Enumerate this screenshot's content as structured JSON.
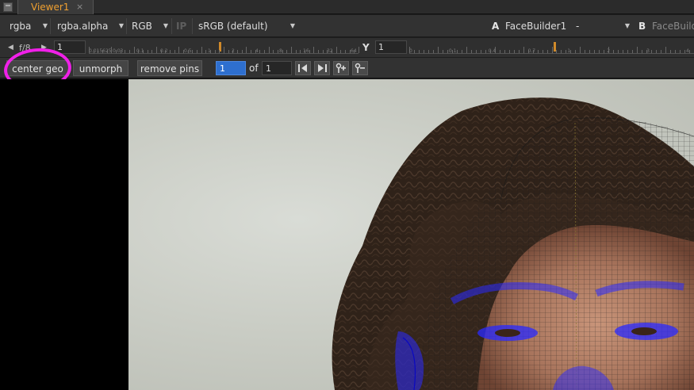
{
  "tab": {
    "title": "Viewer1",
    "close": "×"
  },
  "toolbar": {
    "channels": "rgba",
    "alpha_channel": "rgba.alpha",
    "display_channel": "RGB",
    "ip": "IP",
    "colorspace": "sRGB (default)",
    "input_a_label": "A",
    "input_a_node": "FaceBuilder1",
    "input_a_op": "-",
    "input_b_label": "B",
    "input_b_node": "FaceBuild"
  },
  "gain": {
    "label": "f/8",
    "value": "1",
    "ticks": [
      "0.03125",
      "0.0625",
      "0.125",
      "0.25",
      "0.5",
      "1",
      "2",
      "4",
      "8",
      "16"
    ],
    "tick_labels": [
      "0.015625",
      "0.03",
      "0.1",
      "0.2",
      "0.5",
      "1",
      "2",
      "4",
      "8",
      "16",
      "32",
      "64"
    ]
  },
  "gamma": {
    "label": "Y",
    "value": "1",
    "tick_labels": [
      "0",
      "0.1",
      "0.4",
      "0.7",
      "1",
      "2",
      "3",
      "4"
    ]
  },
  "facebuilder": {
    "center_geo": "center geo",
    "unmorph": "unmorph",
    "remove_pins": "remove pins",
    "current_view": "1",
    "of_label": "of",
    "total_views": "1",
    "icons": [
      "first-view-icon",
      "last-view-icon",
      "add-view-icon",
      "remove-view-icon"
    ]
  },
  "colors": {
    "tab_text": "#f0a030",
    "annotation": "#f020e8",
    "mesh_blue": "#2a2aff",
    "field_active": "#2e6fcf"
  }
}
